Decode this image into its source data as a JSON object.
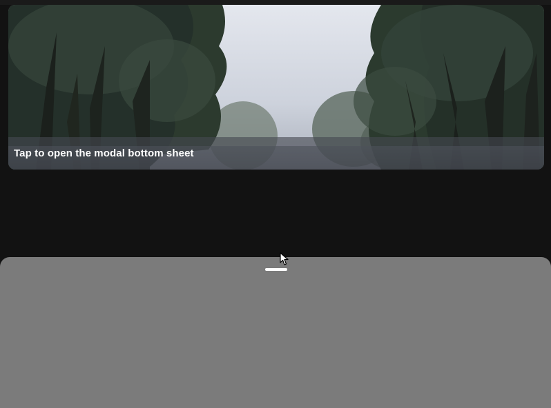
{
  "image_card": {
    "caption": "Tap to open the modal bottom sheet",
    "subject": "misty trees photo"
  },
  "bottom_sheet": {
    "state": "open",
    "color": "#7b7b7b"
  },
  "colors": {
    "background": "#121212",
    "caption_overlay": "#464850",
    "handle": "#ffffff"
  },
  "icons": {
    "cursor": "mouse-pointer-icon",
    "handle": "drag-handle"
  }
}
